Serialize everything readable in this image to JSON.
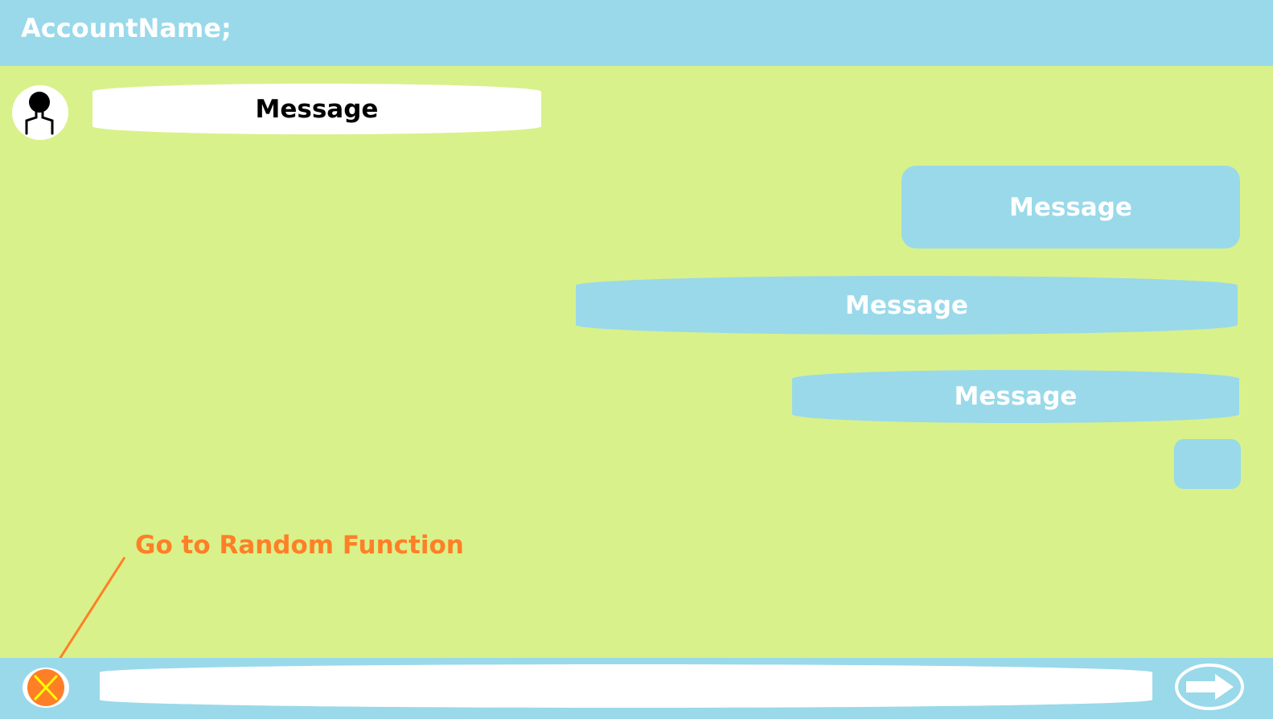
{
  "header": {
    "title": "AccountName;"
  },
  "conversation": {
    "incoming": [
      {
        "text": "Message"
      }
    ],
    "outgoing": [
      {
        "text": "Message"
      },
      {
        "text": "Message"
      },
      {
        "text": "Message"
      },
      {
        "text": ""
      }
    ]
  },
  "annotation": {
    "text": "Go to Random Function",
    "color": "#ff7f27"
  },
  "composer": {
    "value": "",
    "placeholder": ""
  },
  "icons": {
    "avatar": "user-avatar-icon",
    "random": "random-x-icon",
    "send": "send-arrow-icon"
  },
  "colors": {
    "background": "#d9f18a",
    "bars": "#99d9ea",
    "bubble_in": "#ffffff",
    "bubble_out": "#99d9ea",
    "random_icon_fill": "#ff7f27",
    "random_icon_cross": "#ffff00"
  }
}
